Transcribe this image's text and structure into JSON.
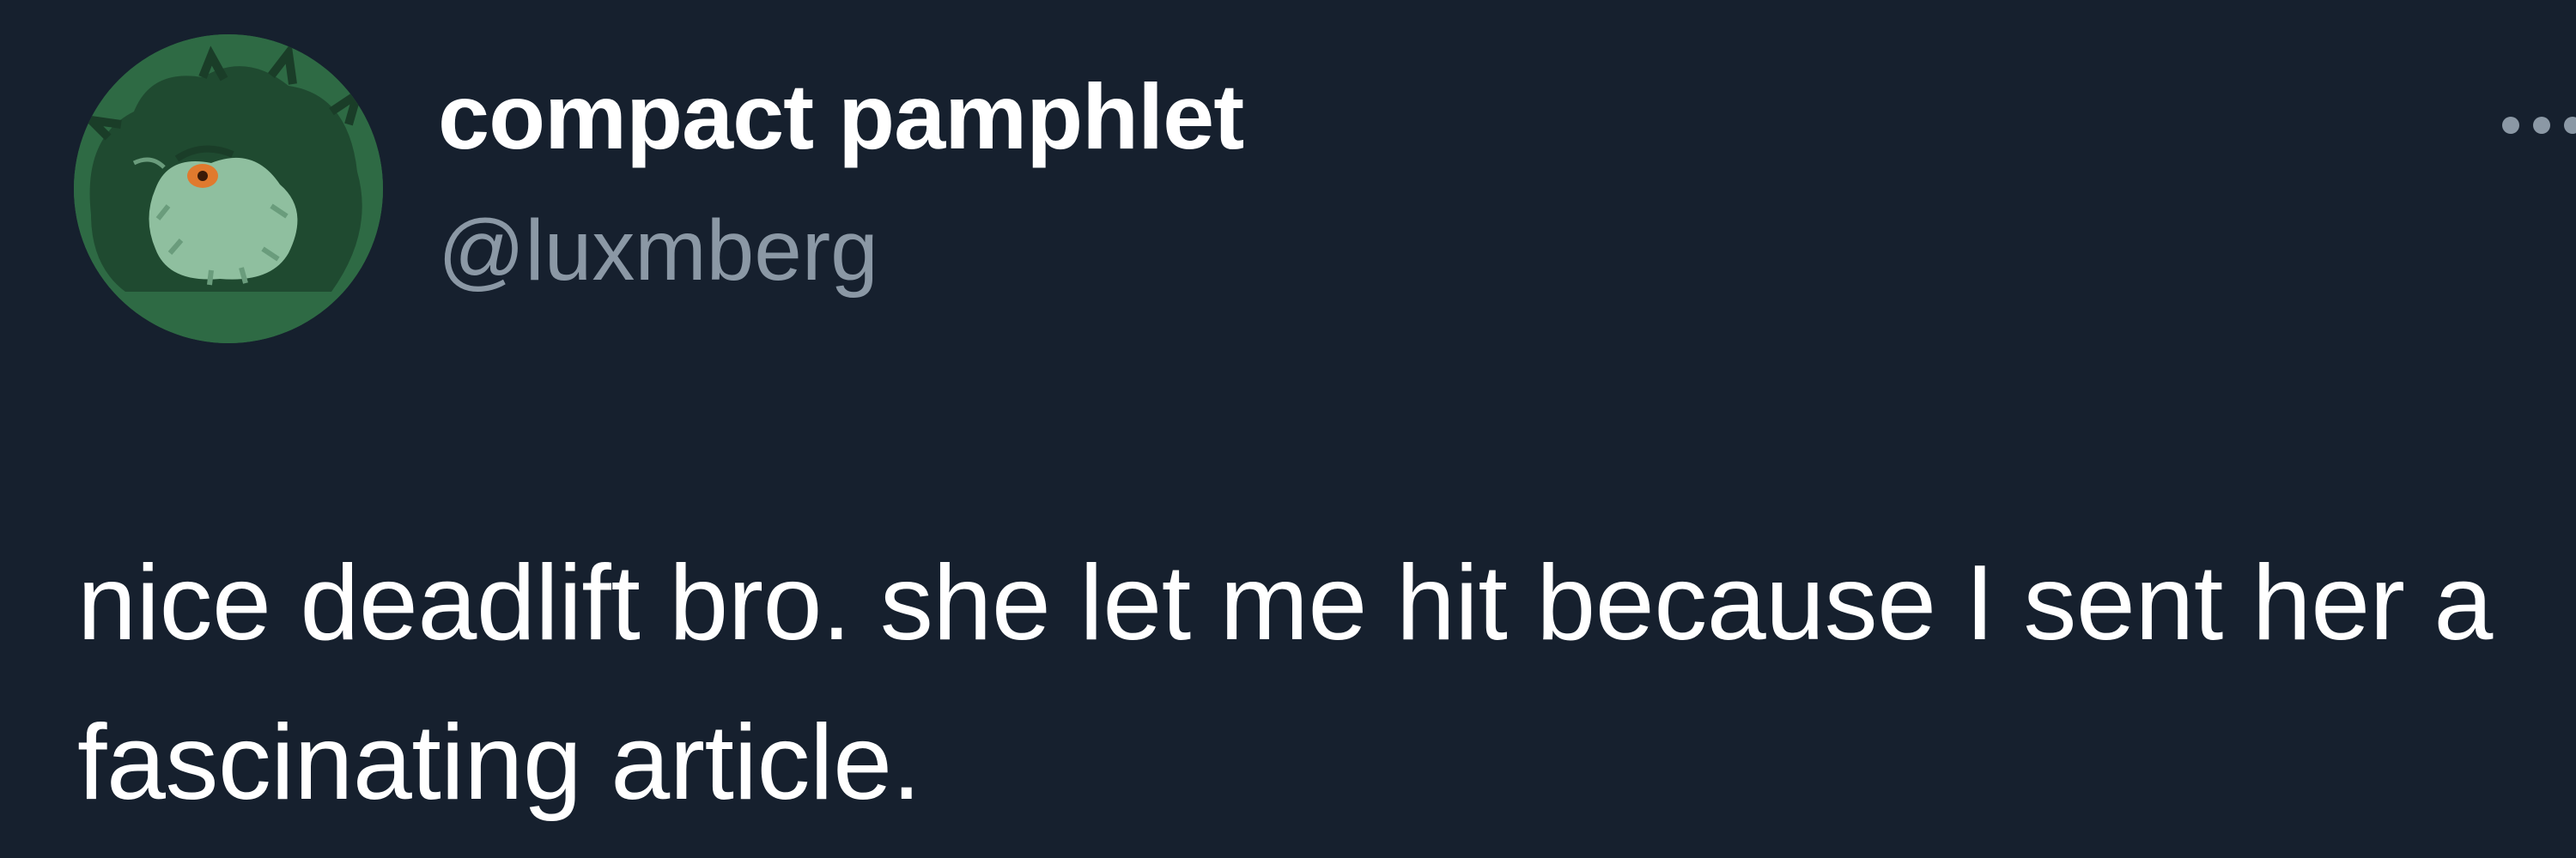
{
  "author": {
    "display_name": "compact pamphlet",
    "handle": "@luxmberg",
    "avatar_icon": "green-creature-avatar"
  },
  "actions": {
    "more_icon": "more-options-icon"
  },
  "tweet": {
    "text": "nice deadlift bro. she let me hit because I sent her a fascinating article."
  },
  "colors": {
    "background": "#16202e",
    "primary_text": "#ffffff",
    "secondary_text": "#8b98a5",
    "avatar_bg": "#2e6a44"
  }
}
